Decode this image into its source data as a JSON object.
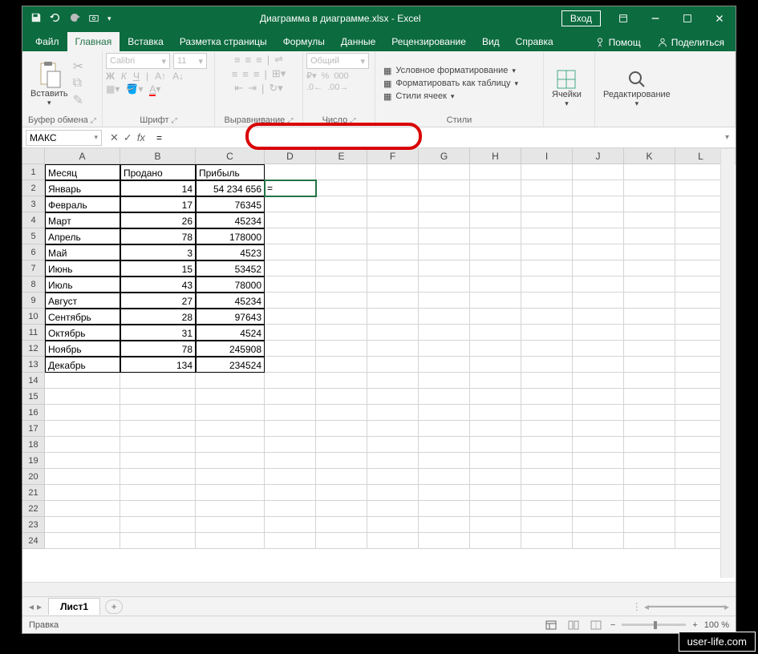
{
  "title": "Диаграмма в диаграмме.xlsx  -  Excel",
  "login": "Вход",
  "tabs": {
    "file": "Файл",
    "home": "Главная",
    "insert": "Вставка",
    "layout": "Разметка страницы",
    "formulas": "Формулы",
    "data": "Данные",
    "review": "Рецензирование",
    "view": "Вид",
    "help": "Справка",
    "helptext": "Помощ",
    "share": "Поделиться"
  },
  "ribbon": {
    "paste": "Вставить",
    "clipboard": "Буфер обмена",
    "font_name": "Calibri",
    "font_size": "11",
    "bold": "Ж",
    "italic": "К",
    "underline": "Ч",
    "font": "Шрифт",
    "align": "Выравнивание",
    "numfmt": "Общий",
    "number": "Число",
    "condfmt": "Условное форматирование",
    "tablefmt": "Форматировать как таблицу",
    "cellstyles": "Стили ячеек",
    "styles": "Стили",
    "cells": "Ячейки",
    "editing": "Редактирование"
  },
  "formula": {
    "namebox": "МАКС",
    "input": "="
  },
  "columns": [
    "A",
    "B",
    "C",
    "D",
    "E",
    "F",
    "G",
    "H",
    "I",
    "J",
    "K",
    "L"
  ],
  "headers": {
    "a": "Месяц",
    "b": "Продано",
    "c": "Прибыль"
  },
  "data_rows": [
    {
      "a": "Январь",
      "b": "14",
      "c": "54 234 656"
    },
    {
      "a": "Февраль",
      "b": "17",
      "c": "76345"
    },
    {
      "a": "Март",
      "b": "26",
      "c": "45234"
    },
    {
      "a": "Апрель",
      "b": "78",
      "c": "178000"
    },
    {
      "a": "Май",
      "b": "3",
      "c": "4523"
    },
    {
      "a": "Июнь",
      "b": "15",
      "c": "53452"
    },
    {
      "a": "Июль",
      "b": "43",
      "c": "78000"
    },
    {
      "a": "Август",
      "b": "27",
      "c": "45234"
    },
    {
      "a": "Сентябрь",
      "b": "28",
      "c": "97643"
    },
    {
      "a": "Октябрь",
      "b": "31",
      "c": "4524"
    },
    {
      "a": "Ноябрь",
      "b": "78",
      "c": "245908"
    },
    {
      "a": "Декабрь",
      "b": "134",
      "c": "234524"
    }
  ],
  "active_cell_value": "=",
  "sheet": "Лист1",
  "status": "Правка",
  "zoom": "100 %",
  "watermark": "user-life.com"
}
